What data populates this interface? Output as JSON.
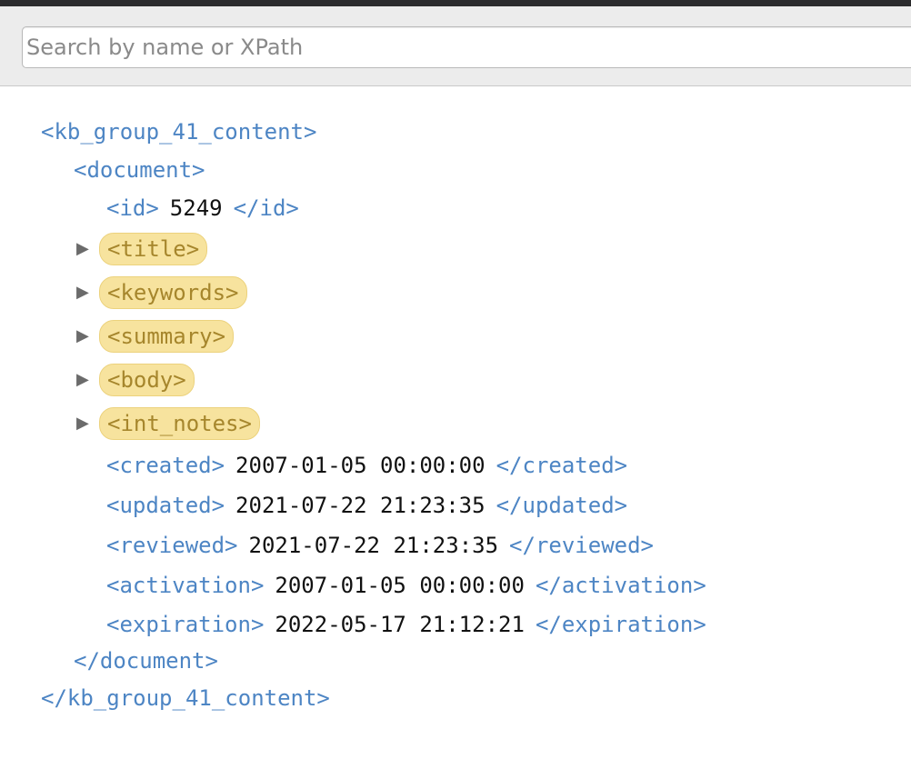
{
  "search": {
    "placeholder": "Search by name or XPath"
  },
  "xml": {
    "root_open": "<kb_group_41_content>",
    "document_open": "<document>",
    "id": {
      "open": "<id>",
      "value": "5249",
      "close": "</id>"
    },
    "collapsed": [
      "<title>",
      "<keywords>",
      "<summary>",
      "<body>",
      "<int_notes>"
    ],
    "fields": [
      {
        "open": "<created>",
        "value": "2007-01-05 00:00:00",
        "close": "</created>"
      },
      {
        "open": "<updated>",
        "value": "2021-07-22 21:23:35",
        "close": "</updated>"
      },
      {
        "open": "<reviewed>",
        "value": "2021-07-22 21:23:35",
        "close": "</reviewed>"
      },
      {
        "open": "<activation>",
        "value": "2007-01-05 00:00:00",
        "close": "</activation>"
      },
      {
        "open": "<expiration>",
        "value": "2022-05-17 21:12:21",
        "close": "</expiration>"
      }
    ],
    "document_close": "</document>",
    "root_close": "</kb_group_41_content>"
  },
  "icons": {
    "expand": "disclosure-triangle-right-icon"
  },
  "colors": {
    "tag": "#4d85c4",
    "value": "#111111",
    "pill_bg": "#f7e39e",
    "pill_text": "#a6862c"
  }
}
